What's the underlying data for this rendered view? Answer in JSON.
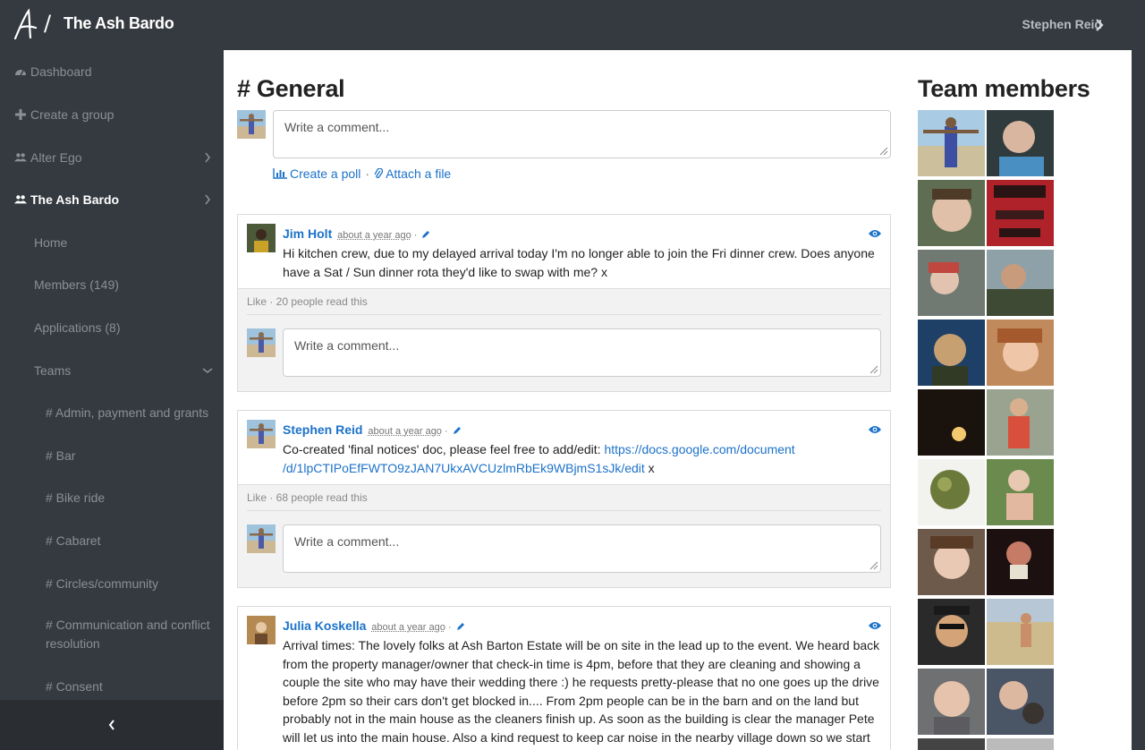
{
  "topbar": {
    "brand_title": "The Ash Bardo",
    "separator": "/",
    "user_name": "Stephen Reid"
  },
  "sidebar": {
    "items": [
      {
        "label": "Dashboard",
        "icon": "dashboard-icon"
      },
      {
        "label": "Create a group",
        "icon": "plus-icon"
      },
      {
        "label": "Alter Ego",
        "icon": "users-icon"
      },
      {
        "label": "The Ash Bardo",
        "icon": "users-icon"
      },
      {
        "label": "Home"
      },
      {
        "label": "Members (149)"
      },
      {
        "label": "Applications (8)"
      },
      {
        "label": "Teams"
      },
      {
        "label": "# Admin, payment and grants"
      },
      {
        "label": "# Bar"
      },
      {
        "label": "# Bike ride"
      },
      {
        "label": "# Cabaret"
      },
      {
        "label": "# Circles/community"
      },
      {
        "label": "# Communication and conflict resolution"
      },
      {
        "label": "# Consent"
      }
    ]
  },
  "main": {
    "title": "# General",
    "composer": {
      "placeholder": "Write a comment...",
      "create_poll": "Create a poll",
      "attach_file": "Attach a file",
      "sep": "·"
    },
    "posts": [
      {
        "author": "Jim Holt",
        "time": "about a year ago",
        "text": "Hi kitchen crew, due to my delayed arrival today I'm no longer able to join the Fri dinner crew. Does anyone have a Sat / Sun dinner rota they'd like to swap with me? x",
        "meta": "Like · 20 people read this",
        "comment_placeholder": "Write a comment..."
      },
      {
        "author": "Stephen Reid",
        "time": "about a year ago",
        "text_before": "Co-created 'final notices' doc, please feel free to add/edit: ",
        "link": "https://docs.google.com/document/d/1lpCTIPoEfFWTO9zJAN7UkxAVCUzlmRbEk9WBjmS1sJk/edit",
        "link_line1": "https://docs.google.com/document",
        "link_line2": "/d/1lpCTIPoEfFWTO9zJAN7UkxAVCUzlmRbEk9WBjmS1sJk/edit",
        "text_after": " x",
        "meta": "Like · 68 people read this",
        "comment_placeholder": "Write a comment..."
      },
      {
        "author": "Julia Koskella",
        "time": "about a year ago",
        "text": "Arrival times: The lovely folks at Ash Barton Estate will be on site in the lead up to the event. We heard back from the property manager/owner that check-in time is 4pm, before that they are cleaning and showing a couple the site who may have their wedding there :) he requests pretty-please that no one goes up the drive before 2pm so their cars don't get blocked in.... From 2pm people can be in the barn and on the land but probably not in the main house as the cleaners finish up. As soon as the building is clear the manager Pete will let us into the main house. Also a kind request to keep car noise in the nearby village down so we start off with good relations."
      }
    ]
  },
  "team": {
    "title": "Team members",
    "photo_count": 18
  },
  "colors": {
    "chrome": "#353a40",
    "link": "#1c72c9",
    "sidebar_text": "#8a8f96"
  }
}
